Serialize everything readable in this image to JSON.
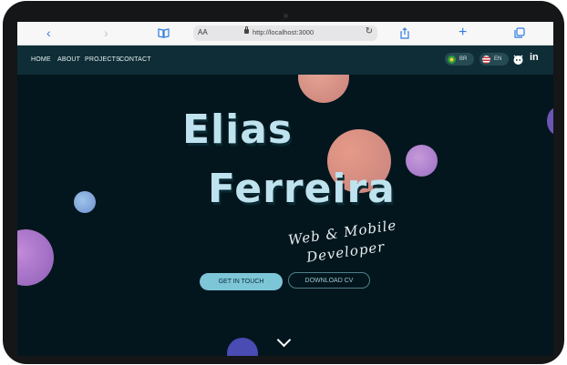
{
  "browser": {
    "aa_label": "AA",
    "url": "http://localhost:3000"
  },
  "nav": {
    "items": [
      "HOME",
      "ABOUT",
      "PROJECTS",
      "CONTACT"
    ],
    "lang_br": "BR",
    "lang_en": "EN",
    "github_icon": "github-icon",
    "linkedin_label": "in"
  },
  "hero": {
    "first_name": "Elias",
    "last_name": "Ferreira",
    "tagline_line1": "Web & Mobile",
    "tagline_line2": "Developer"
  },
  "buttons": {
    "get_in_touch": "GET IN TOUCH",
    "download_cv": "DOWNLOAD CV"
  },
  "colors": {
    "background": "#04161d",
    "nav_bg": "#0f2d36",
    "accent": "#7cc6d8",
    "name_text": "#bfe3ee"
  }
}
